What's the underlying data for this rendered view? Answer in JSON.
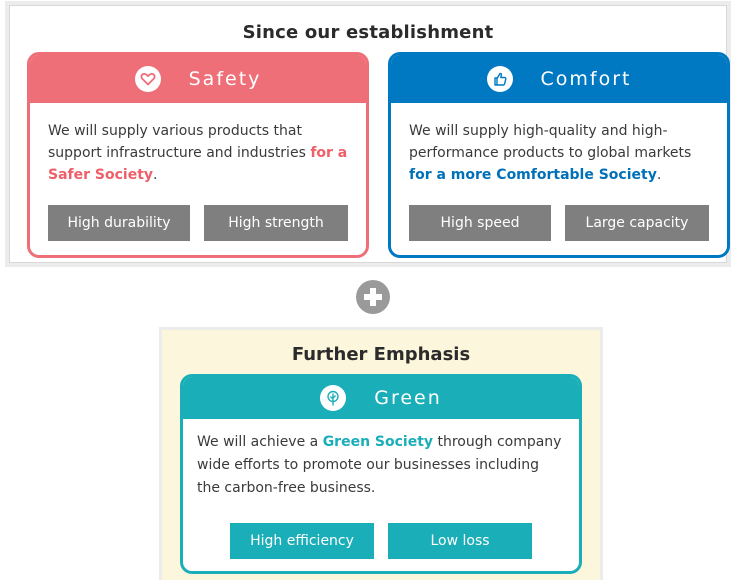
{
  "top": {
    "title": "Since our establishment",
    "safety": {
      "heading": "Safety",
      "text_before": "We will supply various products that support infrastructure and industries ",
      "highlight": "for a Safer Society",
      "text_after": ".",
      "tags": [
        "High durability",
        "High strength"
      ],
      "color": "#ee6f78",
      "icon": "heart-icon"
    },
    "comfort": {
      "heading": "Comfort",
      "text_before": "We will supply high-quality and high-performance products to global markets ",
      "highlight": "for a more Comfortable Society",
      "text_after": ".",
      "tags": [
        "High speed",
        "Large capacity"
      ],
      "color": "#0079c2",
      "icon": "thumbs-up-icon"
    }
  },
  "plus_icon": "plus-icon",
  "bottom": {
    "title": "Further Emphasis",
    "green": {
      "heading": "Green",
      "text_before": "We will achieve a ",
      "highlight": "Green Society",
      "text_after": " through company wide efforts to promote our businesses including the carbon-free business.",
      "tags": [
        "High efficiency",
        "Low loss"
      ],
      "color": "#1aaeb9",
      "background": "#fbf6dc",
      "icon": "tree-icon"
    }
  }
}
